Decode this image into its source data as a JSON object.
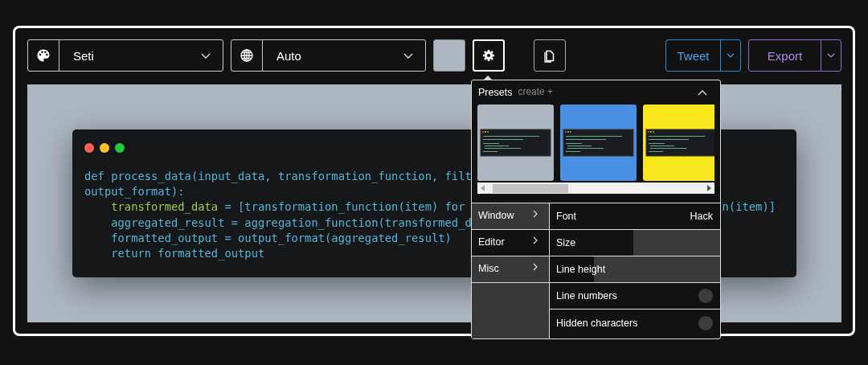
{
  "toolbar": {
    "theme_select": {
      "value": "Seti"
    },
    "language_select": {
      "value": "Auto"
    },
    "background_swatch": {
      "color": "#adb7c1"
    },
    "settings_button": {
      "selected": true
    },
    "tweet_button": {
      "label": "Tweet"
    },
    "export_button": {
      "label": "Export"
    }
  },
  "editor": {
    "lines": [
      {
        "parts": [
          {
            "text": "def process_data(input_data, transformation_function, filt",
            "kind": "plain"
          }
        ]
      },
      {
        "parts": [
          {
            "text": "output_format):",
            "kind": "plain"
          }
        ]
      },
      {
        "parts": [
          {
            "text": "    transformed_data",
            "kind": "name"
          },
          {
            "text": " = [transformation_function(item) for",
            "kind": "plain"
          }
        ],
        "tail": "n(item)]"
      },
      {
        "parts": [
          {
            "text": "    aggregated_result = aggregation_function(transformed_d",
            "kind": "plain"
          }
        ]
      },
      {
        "parts": [
          {
            "text": "    formatted_output = output_format(aggregated_result)",
            "kind": "plain"
          }
        ]
      },
      {
        "parts": [
          {
            "text": "    return formatted_output",
            "kind": "plain"
          }
        ]
      }
    ]
  },
  "settings_panel": {
    "presets_title": "Presets",
    "create_link": "create +",
    "expanded": true,
    "presets": [
      {
        "color": "#adb7c1"
      },
      {
        "color": "#4a90e2"
      },
      {
        "color": "#f8e71c"
      }
    ],
    "menu": [
      {
        "label": "Window",
        "selected": false
      },
      {
        "label": "Editor",
        "selected": true
      },
      {
        "label": "Misc",
        "selected": false
      }
    ],
    "settings": [
      {
        "kind": "value",
        "label": "Font",
        "value": "Hack"
      },
      {
        "kind": "slider",
        "label": "Size",
        "level": 0.49
      },
      {
        "kind": "slider",
        "label": "Line height",
        "level": 0.26
      },
      {
        "kind": "toggle",
        "label": "Line numbers",
        "on": false
      },
      {
        "kind": "toggle",
        "label": "Hidden characters",
        "on": false
      }
    ]
  }
}
